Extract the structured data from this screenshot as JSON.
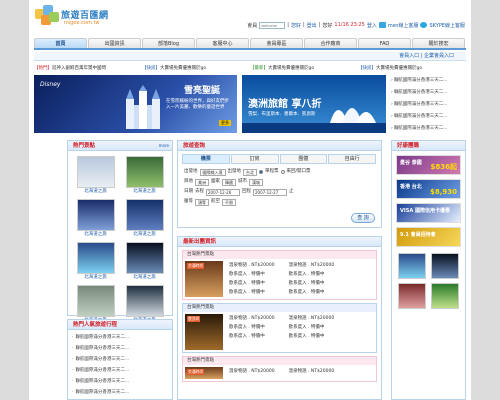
{
  "header": {
    "brand": "旅遊百匯網",
    "domain": "migee.com.tw",
    "member_label": "會員",
    "username_placeholder": "welcome",
    "hello": "您好",
    "logout": "登出",
    "hello2": "您好",
    "time": "11/16 23:25",
    "login": "登入",
    "msn_link": "msn線上客服",
    "skype_link": "SKYPE線上客服"
  },
  "nav": {
    "tabs": [
      "首頁",
      "出國資訊",
      "部落Blog",
      "客服中心",
      "會員專區",
      "合作廠商",
      "FAQ",
      "關於搜宏"
    ],
    "active": 0
  },
  "subnav": "會員入口 | 企業會員入口",
  "ticker": [
    {
      "tag": "【熱門】",
      "text": "延神入銀鯨百萬年獎中國問",
      "color": "red"
    },
    {
      "tag": "【快訊】",
      "text": "大賣場免費優惠關於go",
      "color": "blue"
    },
    {
      "tag": "【最新】",
      "text": "大賣場免費優惠關於go",
      "color": "green"
    },
    {
      "tag": "【快訊】",
      "text": "大賣場免費優惠關於go",
      "color": "blue"
    }
  ],
  "banner1": {
    "logo": "Disney",
    "headline": "雪亮聖誕",
    "sub": "在雪而繽紛的世界，與好友們步入一片美麗、歡樂的童話世界",
    "more": "更多"
  },
  "banner2": {
    "title": "澳洲旅館 享八折",
    "sub": "雪梨．布里斯本．墨爾本．凱恩斯"
  },
  "news_list": [
    "聯航國際滿分香港三天二...",
    "聯航國際滿分香港三天二...",
    "聯航國際滿分香港三天二...",
    "聯航國際滿分香港三天二...",
    "聯航國際滿分香港三天二..."
  ],
  "hot_zone": {
    "title": "熱門景點",
    "more": "more",
    "items": [
      {
        "caption": "北海道之旅",
        "colors": [
          "#b8c8dc",
          "#e8eef4"
        ]
      },
      {
        "caption": "北海道之旅",
        "colors": [
          "#3a6a3a",
          "#8fbf6a"
        ]
      },
      {
        "caption": "北海道之旅",
        "colors": [
          "#1a2c6a",
          "#7fa0d8"
        ]
      },
      {
        "caption": "北海道之旅",
        "colors": [
          "#15306a",
          "#5f7fc0"
        ]
      },
      {
        "caption": "北海道之旅",
        "colors": [
          "#2a4a8a",
          "#7dd0f0"
        ]
      },
      {
        "caption": "北海道之旅",
        "colors": [
          "#08101f",
          "#6a8ab8"
        ]
      },
      {
        "caption": "北海道之旅",
        "colors": [
          "#7a8a7a",
          "#c0d0c0"
        ]
      },
      {
        "caption": "北海道之旅",
        "colors": [
          "#203040",
          "#d0d8e0"
        ]
      }
    ]
  },
  "popular_list": {
    "title": "熱門人氣旅遊行程",
    "items": [
      "聯航國際滿分香港三天二...",
      "聯航國際滿分香港三天二...",
      "聯航國際滿分香港三天二...",
      "聯航國際滿分香港三天二...",
      "聯航國際滿分香港三天二...",
      "聯航國際滿分香港三天二..."
    ]
  },
  "search": {
    "title": "旅遊查詢",
    "tabs": [
      "機票",
      "訂房",
      "團體",
      "自由行"
    ],
    "active_tab": 0,
    "trip_label": "出發地",
    "trip_value": "國際線入境",
    "dest_label": "出發地",
    "dest_value": "台北",
    "radio_1": "單程票",
    "radio_2": "來回/開口票",
    "arrive_label": "目地",
    "arrive_value": "美洲",
    "country_label": "國家",
    "country_value": "韓國",
    "city_label": "城市",
    "city_value": "漢城",
    "date_label": "日期",
    "depart_label": "去程",
    "depart_value": "2007-12-26",
    "return_label": "回程",
    "return_value": "2007-12-27",
    "return_suffix": "止",
    "class_label": "艙等",
    "class_value": "頭等",
    "seat_label": "航空",
    "seat_value": "不限",
    "submit": "查 詢"
  },
  "products": {
    "title": "最新出團資訊",
    "more": "more",
    "categories": [
      {
        "header": "台灣熱門景點",
        "image_label": "交通時尚",
        "col1": [
          "溫泉物語 . NT$20000",
          "歐系度入 . 特價中",
          "歐系度入 . 特價中",
          "歐系度入 . 特價中"
        ],
        "col2": [
          "溫泉物語 . NT$20000",
          "歐系度入 . 特價中",
          "歐系度入 . 特價中",
          "歐系度入 . 特價中"
        ]
      },
      {
        "header": "台灣熱門景點",
        "image_label": "雲頂尚",
        "col1": [
          "溫泉物語 . NT$20000",
          "歐系度入 . 特價中",
          "歐系度入 . 特價中"
        ],
        "col2": [
          "溫泉物語 . NT$20000",
          "歐系度入 . 特價中",
          "歐系度入 . 特價中"
        ]
      },
      {
        "header": "台灣熱門景點",
        "image_label": "交通時尚",
        "col1": [
          "溫泉物語 . NT$20000"
        ],
        "col2": [
          "溫泉物語 . NT$20000"
        ]
      }
    ]
  },
  "deals": {
    "title": "好康團購",
    "ads": [
      {
        "text": "曼谷 泰國",
        "price": "$836起",
        "colors": [
          "#7a3a8a",
          "#d27ab0"
        ]
      },
      {
        "text": "香港 台北",
        "price": "$8,930",
        "colors": [
          "#0a3a8a",
          "#6f9ee6"
        ]
      },
      {
        "text": "VISA 國際信用卡優惠",
        "price": "",
        "colors": [
          "#1a3f9a",
          "#e6f0ff"
        ]
      },
      {
        "text": "9.1 會員招待會",
        "price": "",
        "colors": [
          "#d29a0a",
          "#f6d75a"
        ]
      }
    ],
    "thumbs": [
      {
        "colors": [
          "#2a4a8a",
          "#7dd0f0"
        ]
      },
      {
        "colors": [
          "#08101f",
          "#6a8ab8"
        ]
      },
      {
        "colors": [
          "#7a2a2a",
          "#e0a0a0"
        ]
      },
      {
        "colors": [
          "#2a7a2a",
          "#bfe08a"
        ]
      }
    ]
  }
}
